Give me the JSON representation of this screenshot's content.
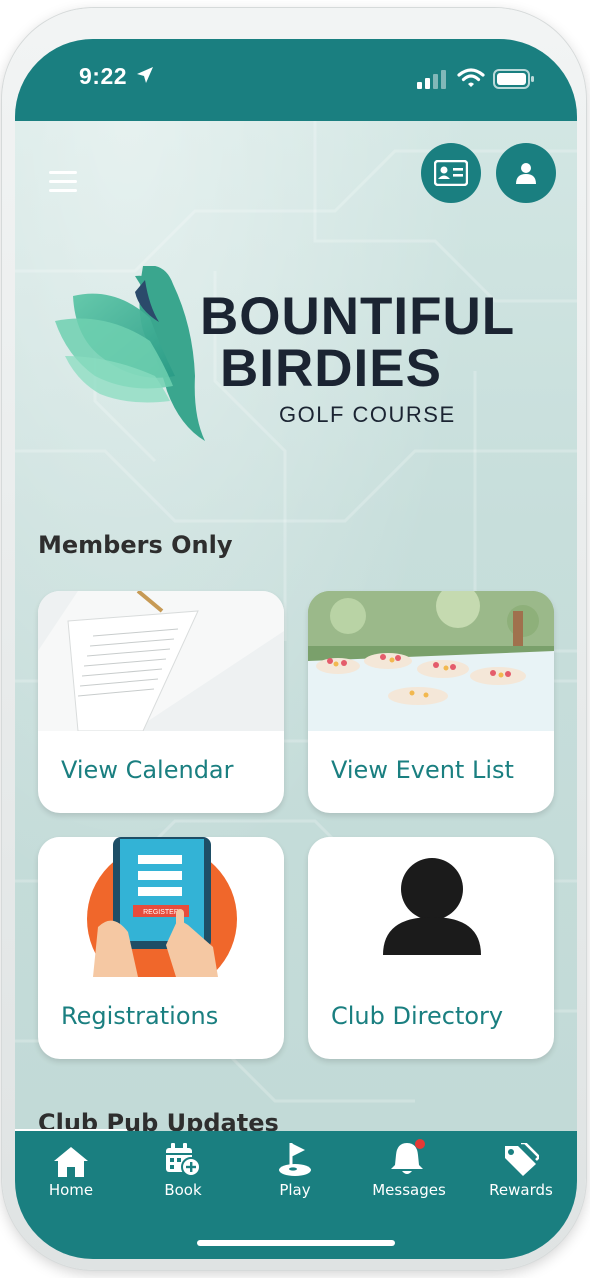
{
  "status_bar": {
    "time": "9:22"
  },
  "header": {
    "menu_icon": "hamburger-icon",
    "card_icon": "member-card-icon",
    "profile_icon": "user-icon"
  },
  "logo": {
    "line1": "BOUNTIFUL",
    "line2": "BIRDIES",
    "line3": "GOLF COURSE"
  },
  "members_section": {
    "title": "Members Only",
    "cards": [
      {
        "label": "View Calendar"
      },
      {
        "label": "View Event List"
      },
      {
        "label": "Registrations"
      },
      {
        "label": "Club Directory"
      }
    ]
  },
  "pub_section": {
    "title": "Club Pub Updates"
  },
  "tabbar": {
    "items": [
      {
        "label": "Home",
        "icon": "home-icon"
      },
      {
        "label": "Book",
        "icon": "calendar-add-icon"
      },
      {
        "label": "Play",
        "icon": "golf-flag-icon"
      },
      {
        "label": "Messages",
        "icon": "bell-icon"
      },
      {
        "label": "Rewards",
        "icon": "tag-icon"
      }
    ]
  },
  "colors": {
    "brand": "#1a7f80",
    "notification": "#e53935",
    "logo_text": "#1b2432"
  }
}
